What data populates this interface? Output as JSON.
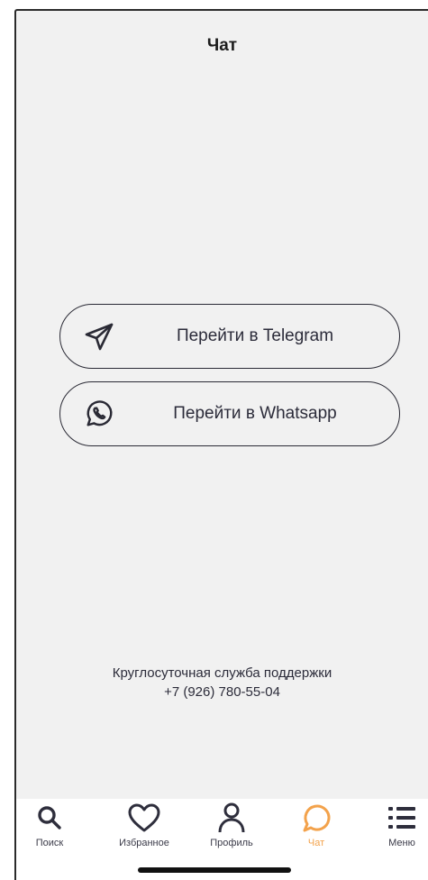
{
  "header": {
    "title": "Чат"
  },
  "buttons": [
    {
      "label": "Перейти в Telegram",
      "icon": "telegram-icon"
    },
    {
      "label": "Перейти в Whatsapp",
      "icon": "whatsapp-icon"
    }
  ],
  "support": {
    "label": "Круглосуточная служба поддержки",
    "phone": "+7 (926) 780-55-04"
  },
  "tabbar": {
    "items": [
      {
        "label": "Поиск",
        "icon": "search-icon",
        "active": false
      },
      {
        "label": "Избранное",
        "icon": "heart-icon",
        "active": false
      },
      {
        "label": "Профиль",
        "icon": "profile-icon",
        "active": false
      },
      {
        "label": "Чат",
        "icon": "chat-icon",
        "active": true
      },
      {
        "label": "Меню",
        "icon": "menu-icon",
        "active": false
      }
    ]
  },
  "colors": {
    "background": "#f1f1f1",
    "accent": "#f3a24b",
    "text": "#2c2c3a"
  }
}
